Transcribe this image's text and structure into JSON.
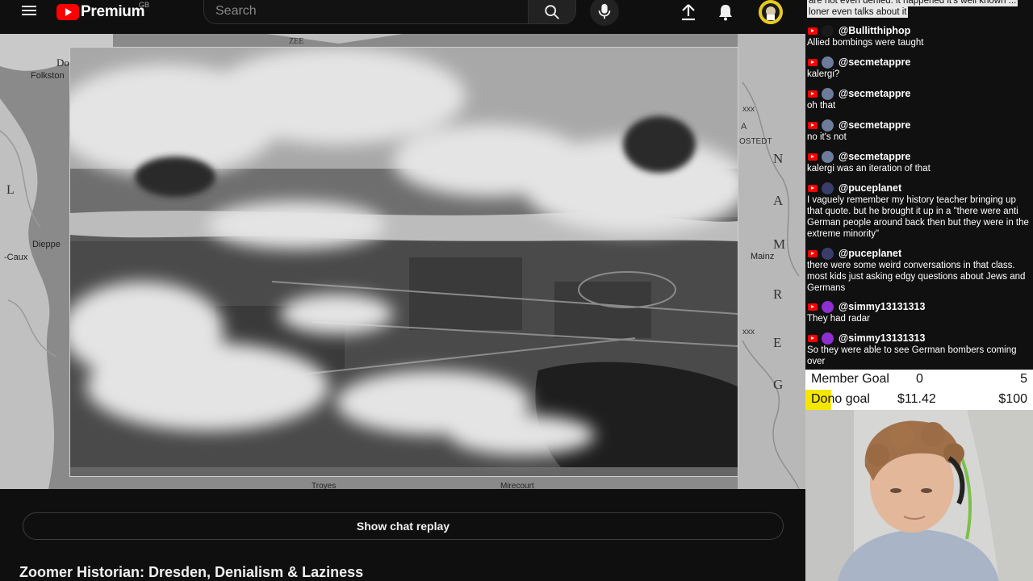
{
  "masthead": {
    "brand_label": "Premium",
    "country_code": "GB",
    "search_placeholder": "Search",
    "icons": [
      "menu-icon",
      "youtube-logo-icon",
      "search-icon",
      "mic-icon",
      "upload-icon",
      "bell-icon",
      "avatar"
    ]
  },
  "player": {
    "map_labels": [
      "Do",
      "Folkston",
      "L",
      "Dieppe",
      "-Caux",
      "ZEE",
      "A",
      "OSTEDT",
      "xxx",
      "N",
      "Mainz",
      "G",
      "E",
      "R",
      "M",
      "A",
      "N",
      "xxx",
      "Troyes",
      "Mirecourt"
    ]
  },
  "below_video": {
    "chat_replay_label": "Show chat replay",
    "title": "Zoomer Historian: Dresden, Denialism & Laziness"
  },
  "chat": {
    "partial_top": {
      "line1": "are not even denied. it happened it's well known ...",
      "line2": "loner even talks about it"
    },
    "messages": [
      {
        "user": "@Bullitthiphop",
        "text": "Allied bombings were taught",
        "avatar_color": "#1a1a1a"
      },
      {
        "user": "@secmetappre",
        "text": "kalergi?",
        "avatar_color": "#6c7c9a"
      },
      {
        "user": "@secmetappre",
        "text": "oh that",
        "avatar_color": "#6c7c9a"
      },
      {
        "user": "@secmetappre",
        "text": "no it's not",
        "avatar_color": "#6c7c9a"
      },
      {
        "user": "@secmetappre",
        "text": "kalergi was an iteration of that",
        "avatar_color": "#6c7c9a"
      },
      {
        "user": "@puceplanet",
        "text": "I vaguely remember my history teacher bringing up that quote. but he brought it up in a \"there were anti German people around back then but they were in the extreme minority\"",
        "avatar_color": "#3a3d6a"
      },
      {
        "user": "@puceplanet",
        "text": "there were some weird conversations in that class. most kids just asking edgy questions about Jews and Germans",
        "avatar_color": "#3a3d6a"
      },
      {
        "user": "@simmy13131313",
        "text": "They had radar",
        "avatar_color": "#8e2fd0"
      },
      {
        "user": "@simmy13131313",
        "text": "So they were able to see German bombers coming over",
        "avatar_color": "#8e2fd0"
      }
    ]
  },
  "goals": {
    "member": {
      "label": "Member Goal",
      "current": "0",
      "target": "5"
    },
    "dono": {
      "label": "Dono goal",
      "current": "$11.42",
      "target": "$100",
      "progress_fraction": 0.114
    }
  },
  "colors": {
    "page_bg": "#0f0f0f",
    "yt_red": "#ff0000",
    "goal_highlight": "#f5e600"
  }
}
